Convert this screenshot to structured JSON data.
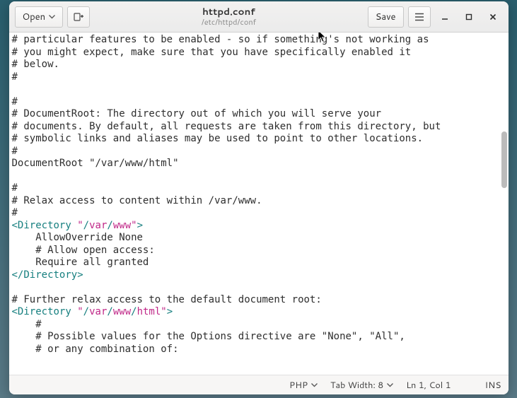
{
  "header": {
    "open_label": "Open",
    "save_label": "Save",
    "title": "httpd.conf",
    "subtitle": "/etc/httpd/conf"
  },
  "editor": {
    "lines": [
      {
        "t": "plain",
        "text": "# particular features to be enabled - so if something's not working as"
      },
      {
        "t": "plain",
        "text": "# you might expect, make sure that you have specifically enabled it"
      },
      {
        "t": "plain",
        "text": "# below."
      },
      {
        "t": "plain",
        "text": "#"
      },
      {
        "t": "plain",
        "text": ""
      },
      {
        "t": "plain",
        "text": "#"
      },
      {
        "t": "plain",
        "text": "# DocumentRoot: The directory out of which you will serve your"
      },
      {
        "t": "plain",
        "text": "# documents. By default, all requests are taken from this directory, but"
      },
      {
        "t": "plain",
        "text": "# symbolic links and aliases may be used to point to other locations."
      },
      {
        "t": "plain",
        "text": "#"
      },
      {
        "t": "plain",
        "text": "DocumentRoot \"/var/www/html\""
      },
      {
        "t": "plain",
        "text": ""
      },
      {
        "t": "plain",
        "text": "#"
      },
      {
        "t": "plain",
        "text": "# Relax access to content within /var/www."
      },
      {
        "t": "plain",
        "text": "#"
      },
      {
        "t": "dir_open",
        "raw": "<Directory \"/var/www\">"
      },
      {
        "t": "plain",
        "text": "    AllowOverride None"
      },
      {
        "t": "plain",
        "text": "    # Allow open access:"
      },
      {
        "t": "plain",
        "text": "    Require all granted"
      },
      {
        "t": "dir_close",
        "raw": "</Directory>"
      },
      {
        "t": "plain",
        "text": ""
      },
      {
        "t": "plain",
        "text": "# Further relax access to the default document root:"
      },
      {
        "t": "dir_open",
        "raw": "<Directory \"/var/www/html\">"
      },
      {
        "t": "plain",
        "text": "    #"
      },
      {
        "t": "plain",
        "text": "    # Possible values for the Options directive are \"None\", \"All\","
      },
      {
        "t": "plain",
        "text": "    # or any combination of:"
      }
    ]
  },
  "statusbar": {
    "language": "PHP",
    "tab_width": "Tab Width: 8",
    "position": "Ln 1, Col 1",
    "mode": "INS"
  }
}
